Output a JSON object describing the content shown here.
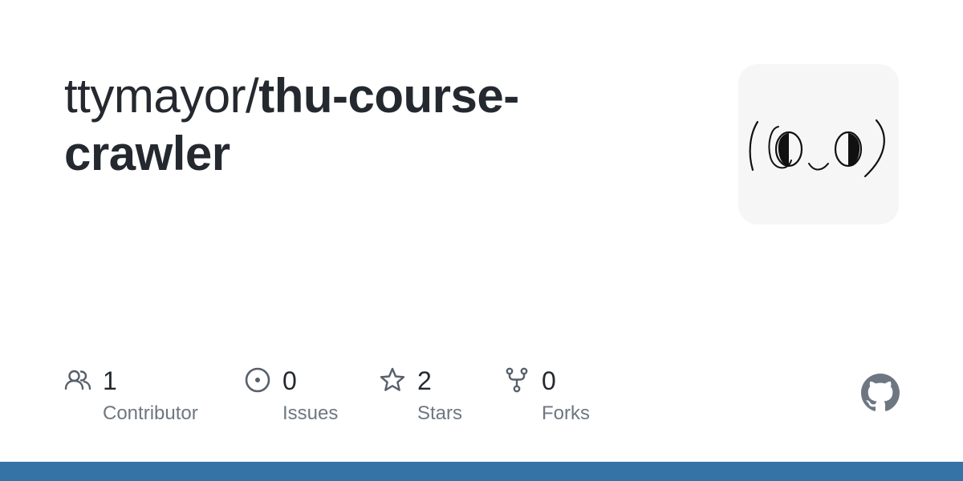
{
  "repo": {
    "owner": "ttymayor",
    "separator": "/",
    "name": "thu-course-crawler"
  },
  "avatar": {
    "icon": "face-doodle-icon",
    "description_text": "(●_●)"
  },
  "stats": [
    {
      "icon": "people-icon",
      "count": "1",
      "label": "Contributor"
    },
    {
      "icon": "issue-circle-icon",
      "count": "0",
      "label": "Issues"
    },
    {
      "icon": "star-icon",
      "count": "2",
      "label": "Stars"
    },
    {
      "icon": "fork-icon",
      "count": "0",
      "label": "Forks"
    }
  ],
  "colors": {
    "text_primary": "#24292f",
    "text_secondary": "#6e7781",
    "icon": "#57606a",
    "logo": "#6e7781",
    "bar": "#3572A5"
  }
}
